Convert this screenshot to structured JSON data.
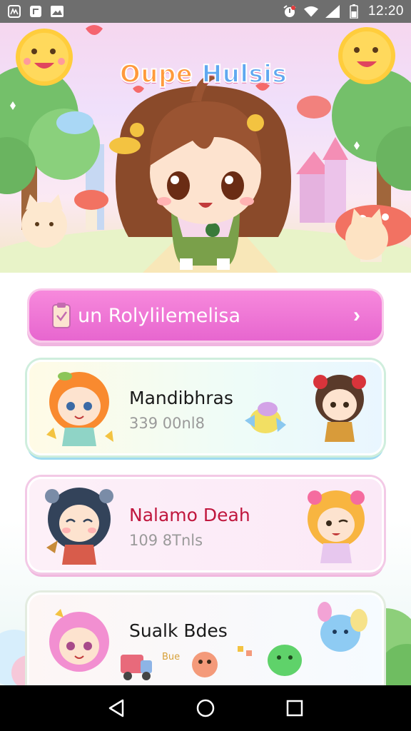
{
  "status_bar": {
    "left_icons": [
      "gallery-icon",
      "app-icon",
      "image-icon"
    ],
    "right_icons": [
      "alarm-icon",
      "wifi-icon",
      "signal-icon",
      "battery-icon"
    ],
    "time": "12:20"
  },
  "hero": {
    "title_part1": "Oupe",
    "title_part2": "Hulsis"
  },
  "cta": {
    "label": "un Rolylilemelisa",
    "icon": "clipboard-icon",
    "chevron": "›"
  },
  "cards": [
    {
      "title": "Mandibhras",
      "subtitle": "339 00nl8"
    },
    {
      "title": "Nalamo  Deah",
      "subtitle": "109 8Tnls"
    },
    {
      "title": "Sualk Bdes",
      "subtitle": "",
      "tag": "Bue"
    }
  ],
  "nav": {
    "buttons": [
      "back-icon",
      "home-icon",
      "recents-icon"
    ]
  },
  "colors": {
    "cta_pink": "#ee72d4",
    "card2_title": "#c0173e",
    "status_bar": "#6e6e6e",
    "nav_bar": "#000000"
  }
}
